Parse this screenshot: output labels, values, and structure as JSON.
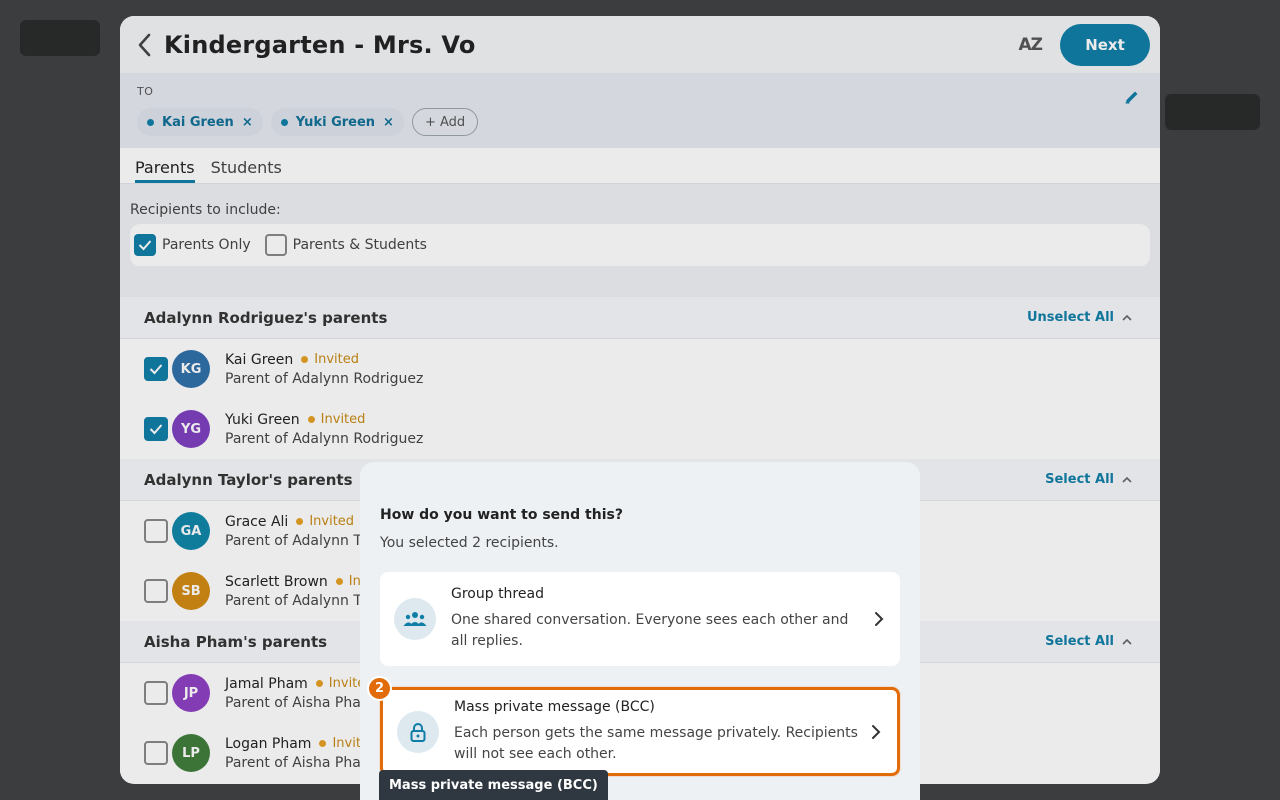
{
  "modal": {
    "title": "Kindergarten - Mrs. Vo",
    "sort_icon": "AZ",
    "next_label": "Next"
  },
  "to": {
    "label": "TO",
    "chips": [
      {
        "name": "Kai Green",
        "remove": "×"
      },
      {
        "name": "Yuki Green",
        "remove": "×"
      }
    ],
    "add_label": "+ Add"
  },
  "tabs": [
    {
      "label": "Parents",
      "active": true
    },
    {
      "label": "Students",
      "active": false
    }
  ],
  "filter": {
    "label": "Recipients to include:",
    "options": [
      {
        "label": "Parents Only",
        "checked": true
      },
      {
        "label": "Parents & Students",
        "checked": false
      }
    ]
  },
  "groups": [
    {
      "title": "Adalynn Rodriguez's parents",
      "action": "Unselect All",
      "people": [
        {
          "initials": "KG",
          "name": "Kai Green",
          "status": "Invited",
          "role": "Parent of Adalynn Rodriguez",
          "checked": true,
          "color": "#2f6fa8"
        },
        {
          "initials": "YG",
          "name": "Yuki Green",
          "status": "Invited",
          "role": "Parent of Adalynn Rodriguez",
          "checked": true,
          "color": "#7e3fc0"
        }
      ]
    },
    {
      "title": "Adalynn Taylor's parents",
      "action": "Select All",
      "people": [
        {
          "initials": "GA",
          "name": "Grace Ali",
          "status": "Invited",
          "role": "Parent of Adalynn Taylor",
          "checked": false,
          "color": "#0f86a8"
        },
        {
          "initials": "SB",
          "name": "Scarlett Brown",
          "status": "Invited",
          "role": "Parent of Adalynn Taylor",
          "checked": false,
          "color": "#d48a10"
        }
      ]
    },
    {
      "title": "Aisha Pham's parents",
      "action": "Select All",
      "people": [
        {
          "initials": "JP",
          "name": "Jamal Pham",
          "status": "Invited",
          "role": "Parent of Aisha Pham",
          "checked": false,
          "color": "#8e3fc2"
        },
        {
          "initials": "LP",
          "name": "Logan Pham",
          "status": "Invited",
          "role": "Parent of Aisha Pham",
          "checked": false,
          "color": "#3f7d3a"
        }
      ]
    }
  ],
  "send_dialog": {
    "title": "How do you want to send this?",
    "subtitle": "You selected 2 recipients.",
    "options": [
      {
        "title": "Group thread",
        "description": "One shared conversation. Everyone sees each other and all replies.",
        "icon": "group-icon"
      },
      {
        "title": "Mass private message (BCC)",
        "description": "Each person gets the same message privately. Recipients will not see each other.",
        "icon": "lock-icon",
        "badge": "2"
      }
    ]
  },
  "tooltip": "Mass private message (BCC)",
  "colors": {
    "accent": "#0f7ea6",
    "highlight": "#e36c0a",
    "invited": "#c88a12"
  }
}
